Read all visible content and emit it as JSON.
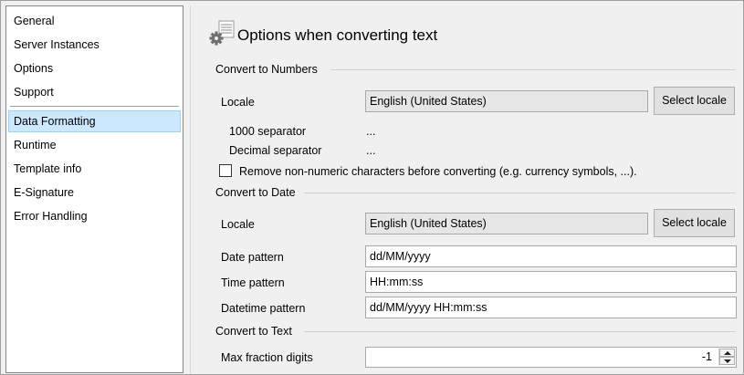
{
  "sidebar": {
    "items": [
      {
        "label": "General"
      },
      {
        "label": "Server Instances"
      },
      {
        "label": "Options"
      },
      {
        "label": "Support"
      },
      {
        "label": "Data Formatting",
        "selected": true
      },
      {
        "label": "Runtime"
      },
      {
        "label": "Template info"
      },
      {
        "label": "E-Signature"
      },
      {
        "label": "Error Handling"
      }
    ]
  },
  "main": {
    "title": "Options when converting text",
    "icon": "gear-document-icon",
    "numbers": {
      "header": "Convert to Numbers",
      "locale_label": "Locale",
      "locale_value": "English (United States)",
      "select_locale": "Select locale",
      "thousand_sep_label": "1000 separator",
      "thousand_sep_value": "...",
      "decimal_sep_label": "Decimal separator",
      "decimal_sep_value": "...",
      "remove_nonnumeric_label": "Remove non-numeric characters before converting (e.g. currency symbols, ...).",
      "remove_nonnumeric_checked": false
    },
    "date": {
      "header": "Convert to Date",
      "locale_label": "Locale",
      "locale_value": "English (United States)",
      "select_locale": "Select locale",
      "date_pattern_label": "Date pattern",
      "date_pattern_value": "dd/MM/yyyy",
      "time_pattern_label": "Time pattern",
      "time_pattern_value": "HH:mm:ss",
      "datetime_pattern_label": "Datetime pattern",
      "datetime_pattern_value": "dd/MM/yyyy HH:mm:ss"
    },
    "text": {
      "header": "Convert to Text",
      "max_fraction_label": "Max fraction digits",
      "max_fraction_value": "-1"
    }
  }
}
